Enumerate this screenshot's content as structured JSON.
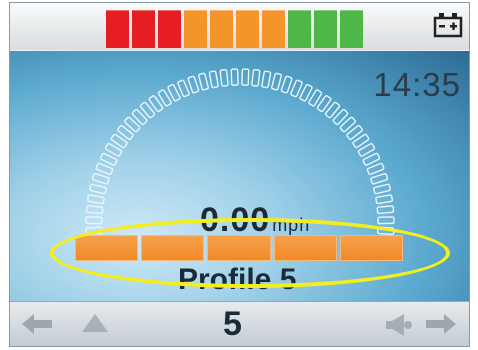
{
  "clock": "14:35",
  "battery": {
    "segments": [
      {
        "color": "#e61e24"
      },
      {
        "color": "#e61e24"
      },
      {
        "color": "#e61e24"
      },
      {
        "color": "#f5942a"
      },
      {
        "color": "#f5942a"
      },
      {
        "color": "#f5942a"
      },
      {
        "color": "#f5942a"
      },
      {
        "color": "#4fb748"
      },
      {
        "color": "#4fb748"
      },
      {
        "color": "#4fb748"
      }
    ],
    "icon": "battery-icon"
  },
  "speed": {
    "value": "0.00",
    "unit": "mph"
  },
  "speed_bar": {
    "segments": 5,
    "color": "#f08a28"
  },
  "dial": {
    "ticks": 48
  },
  "highlight": {
    "color": "#f2ee1f"
  },
  "profile": {
    "label": "Profile 5",
    "number": "5"
  },
  "nav": {
    "left_icons": [
      "left-arrow-icon",
      "up-arrow-icon"
    ],
    "right_icons": [
      "horn-icon",
      "right-arrow-icon"
    ]
  }
}
